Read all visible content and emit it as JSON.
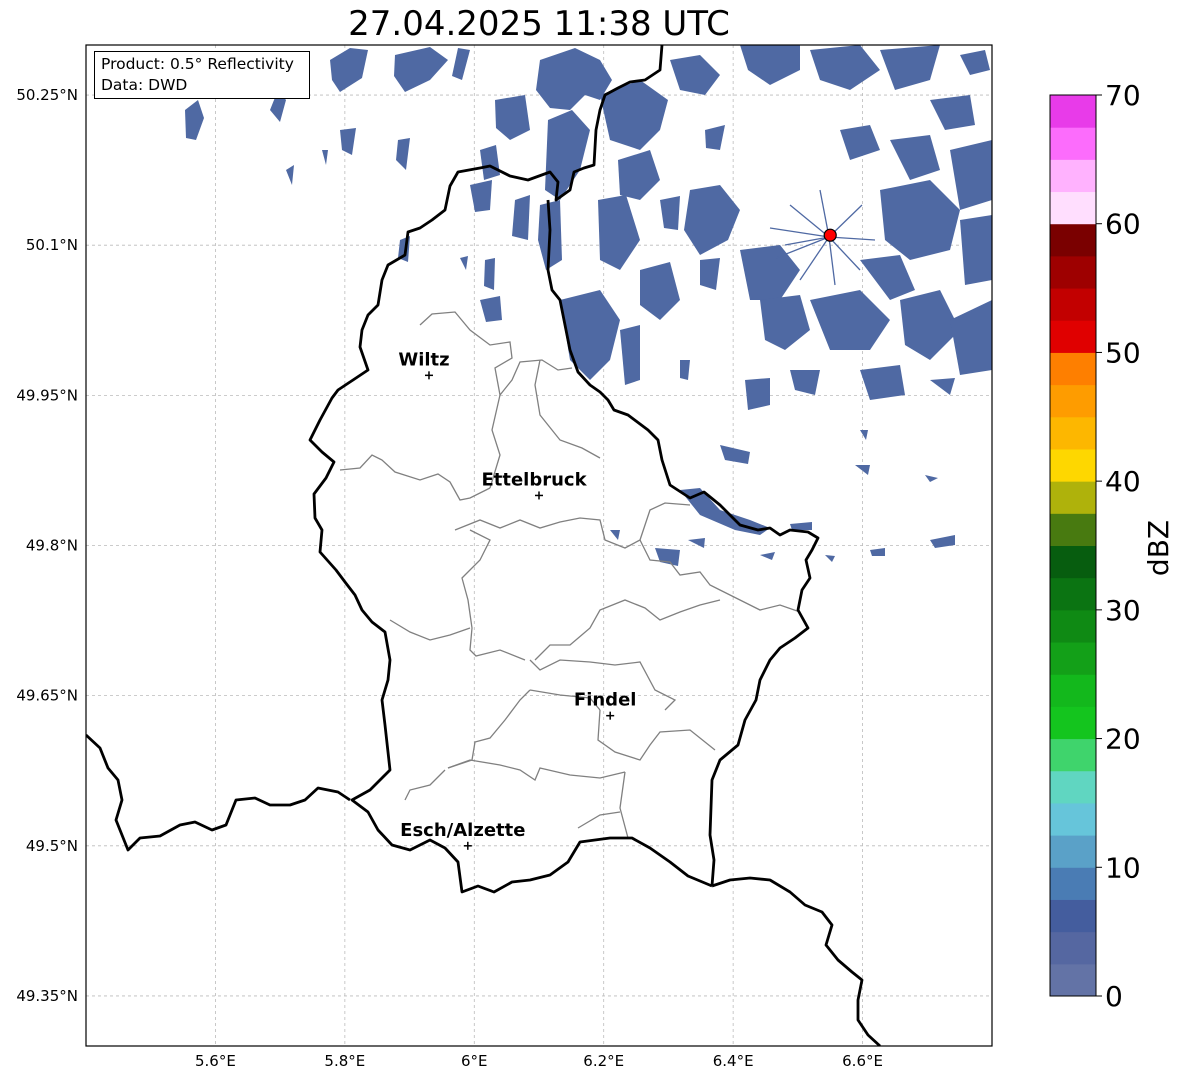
{
  "title": "27.04.2025 11:38 UTC",
  "info": {
    "product": "Product: 0.5° Reflectivity",
    "data": "Data: DWD"
  },
  "map": {
    "lon_range": [
      5.4,
      6.8
    ],
    "lat_range": [
      49.3,
      50.3
    ],
    "lon_ticks": [
      "5.6°E",
      "5.8°E",
      "6°E",
      "6.2°E",
      "6.4°E",
      "6.6°E"
    ],
    "lat_ticks": [
      "50.25°N",
      "50.1°N",
      "49.95°N",
      "49.8°N",
      "49.65°N",
      "49.5°N",
      "49.35°N"
    ],
    "grid": true,
    "cities": [
      {
        "name": "Wiltz",
        "lon": 5.93,
        "lat": 49.97
      },
      {
        "name": "Ettelbruck",
        "lon": 6.1,
        "lat": 49.85
      },
      {
        "name": "Findel",
        "lon": 6.21,
        "lat": 49.63
      },
      {
        "name": "Esch/Alzette",
        "lon": 5.99,
        "lat": 49.5
      }
    ],
    "radar_site": {
      "lon": 6.55,
      "lat": 50.11
    }
  },
  "colorbar": {
    "label": "dBZ",
    "ticks": [
      "0",
      "10",
      "20",
      "30",
      "40",
      "50",
      "60",
      "70"
    ],
    "min": 0,
    "max": 70,
    "colors": [
      "#6373a6",
      "#5567a1",
      "#445d9e",
      "#4a7cb4",
      "#5aa1c8",
      "#66c5da",
      "#60d6c1",
      "#3fd46c",
      "#14c51e",
      "#13b81c",
      "#13a018",
      "#0f8a14",
      "#0b7412",
      "#075d0f",
      "#487a10",
      "#afb20b",
      "#fed700",
      "#fdb700",
      "#fe9c00",
      "#fe7f00",
      "#e00000",
      "#c20000",
      "#9e0000",
      "#7a0000",
      "#ffdefe",
      "#ffb2fe",
      "#fc6cfc",
      "#e83be9"
    ]
  }
}
